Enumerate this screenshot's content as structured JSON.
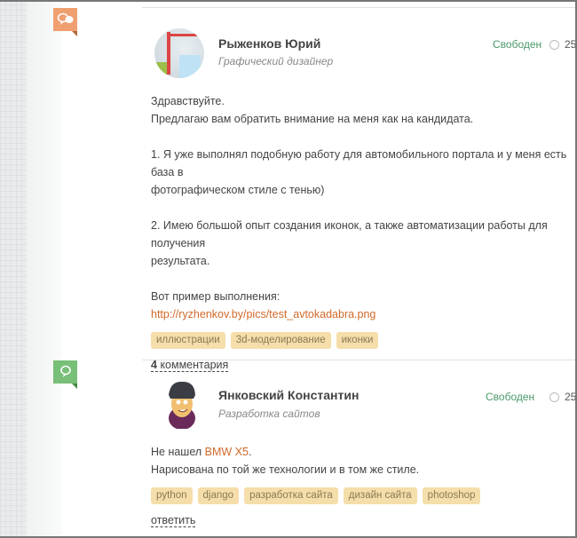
{
  "posts": [
    {
      "name": "Рыженков Юрий",
      "role": "Графический дизайнер",
      "status": "Свободен",
      "date": "25",
      "lines": [
        "Здравствуйте.",
        "Предлагаю вам обратить внимание на меня как на кандидата.",
        "",
        "1. Я уже выполнял подобную работу для автомобильного портала и у меня есть база в",
        "фотографическом стиле с тенью)",
        "",
        "2. Имею большой опыт создания иконок, а также автоматизации работы для получения",
        "результата.",
        "",
        "Вот пример выполнения:"
      ],
      "url": "http://ryzhenkov.by/pics/test_avtokadabra.png",
      "tags": [
        "иллюстрации",
        "3d-моделирование",
        "иконки"
      ],
      "comments_count": "4",
      "comments_label": "комментария"
    },
    {
      "name": "Янковский Константин",
      "role": "Разработка сайтов",
      "status": "Свободен",
      "date": "25",
      "text_prefix": "Не нашел ",
      "link_text": "BMW X5",
      "text_suffix": ".",
      "line2": "Нарисована по той же технологии и в том же стиле.",
      "tags": [
        "python",
        "django",
        "разработка сайта",
        "дизайн сайта",
        "photoshop"
      ],
      "reply_label": "ответить"
    }
  ],
  "colors": {
    "orange_badge": "#f0a070",
    "green_badge": "#78bf78",
    "status": "#4a9a6a",
    "link": "#d2692a",
    "tag_bg": "#f5deaa"
  }
}
